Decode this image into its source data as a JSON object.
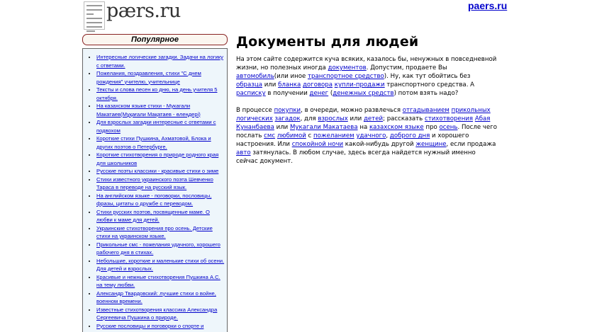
{
  "header": {
    "logo_text": "pærs.ru",
    "site_link": "paers.ru"
  },
  "sidebar": {
    "title": "Популярное",
    "items": [
      "Интересные логические загадки. Задачи на логику с ответами.",
      "Пожелания, поздравления, стихи \"С днем рождения\" учителю, учительнице",
      "Тексты и слова песен ко дню, на день учителя 5 октября.",
      "На казахском языке стихи - Мукагали Макатаев(Мұқағали Мақатаев - өлеңдері)",
      "Для взрослых загадки интересные с ответами с подвохом",
      "Короткие стихи Пушкина, Ахматовой, Блока и других поэтов о Петербурге.",
      "Короткие стихотворения о природе родного края для школьников",
      "Русские поэты классики - красивые стихи о зиме",
      "Стихи известного украинского поэта Шевченко Тараса в переводе на русский язык.",
      "На английском языке - поговорки, пословицы, фразы, цитаты о дружбе с переводом.",
      "Стихи русских поэтов, посвященные маме. О любви к маме для детей.",
      "Украинские стихотворения про осень. Детские стихи на украинском языке.",
      "Прикольные смс - пожелания удачного, хорошего рабочего дня в стихах.",
      "Небольшие, короткие и маленькие стихи об осени. Для детей и взрослых.",
      "Красивые и нежные стихотворения Пушкина А.С. на тему любви.",
      "Александр Твардовский: лучшие стихи о войне, военном времени.",
      "Известные стихотворения классика Александра Сергеевича Пушкина о природе.",
      "Русские пословицы и поговорки о спорте и"
    ]
  },
  "main": {
    "title": "Документы для людей",
    "p1": [
      {
        "t": "На этом сайте содержится куча всяких, казалось бы, ненужных в повседневной жизни, но полезных иногда "
      },
      {
        "t": "документов",
        "link": true
      },
      {
        "t": ". Допустим, продаете Вы "
      },
      {
        "t": "автомобиль",
        "link": true
      },
      {
        "t": "(или иное "
      },
      {
        "t": "транспортное средство",
        "link": true
      },
      {
        "t": "). Ну, как тут обойтись без "
      },
      {
        "t": "образца",
        "link": true
      },
      {
        "t": " или "
      },
      {
        "t": "бланка",
        "link": true
      },
      {
        "t": " "
      },
      {
        "t": "договора",
        "link": true
      },
      {
        "t": " "
      },
      {
        "t": "купли-продажи",
        "link": true
      },
      {
        "t": " транспортного средства. А "
      },
      {
        "t": "расписку",
        "link": true
      },
      {
        "t": " в получении "
      },
      {
        "t": "денег",
        "link": true
      },
      {
        "t": " ("
      },
      {
        "t": "денежных средств",
        "link": true
      },
      {
        "t": ") потом взять надо?"
      }
    ],
    "p2": [
      {
        "t": "В процессе "
      },
      {
        "t": "покупки",
        "link": true
      },
      {
        "t": ", в очереди, можно развлечься "
      },
      {
        "t": "отгадыванием",
        "link": true
      },
      {
        "t": " "
      },
      {
        "t": "прикольных",
        "link": true
      },
      {
        "t": " "
      },
      {
        "t": "логических",
        "link": true
      },
      {
        "t": " "
      },
      {
        "t": "загадок",
        "link": true
      },
      {
        "t": ", для "
      },
      {
        "t": "взрослых",
        "link": true
      },
      {
        "t": " или "
      },
      {
        "t": "детей",
        "link": true
      },
      {
        "t": "; рассказать "
      },
      {
        "t": "стихотворения",
        "link": true
      },
      {
        "t": " "
      },
      {
        "t": "Абая Кунанбаева",
        "link": true
      },
      {
        "t": " или "
      },
      {
        "t": "Мукагали Макатаева",
        "link": true
      },
      {
        "t": " на "
      },
      {
        "t": "казахском языке",
        "link": true
      },
      {
        "t": " про "
      },
      {
        "t": "осень",
        "link": true
      },
      {
        "t": ". После чего послать "
      },
      {
        "t": "смс",
        "link": true
      },
      {
        "t": " "
      },
      {
        "t": "любимой",
        "link": true
      },
      {
        "t": " с "
      },
      {
        "t": "пожеланием",
        "link": true
      },
      {
        "t": " "
      },
      {
        "t": "удачного",
        "link": true
      },
      {
        "t": ", "
      },
      {
        "t": "доброго дня",
        "link": true
      },
      {
        "t": " и хорошего настроения. Или "
      },
      {
        "t": "спокойной ночи",
        "link": true
      },
      {
        "t": " какой-нибудь другой "
      },
      {
        "t": "женщине",
        "link": true
      },
      {
        "t": ", если продажа "
      },
      {
        "t": "авто",
        "link": true
      },
      {
        "t": " затянулась. В любом случае, здесь всегда найдется нужный именно сейчас документ."
      }
    ]
  }
}
